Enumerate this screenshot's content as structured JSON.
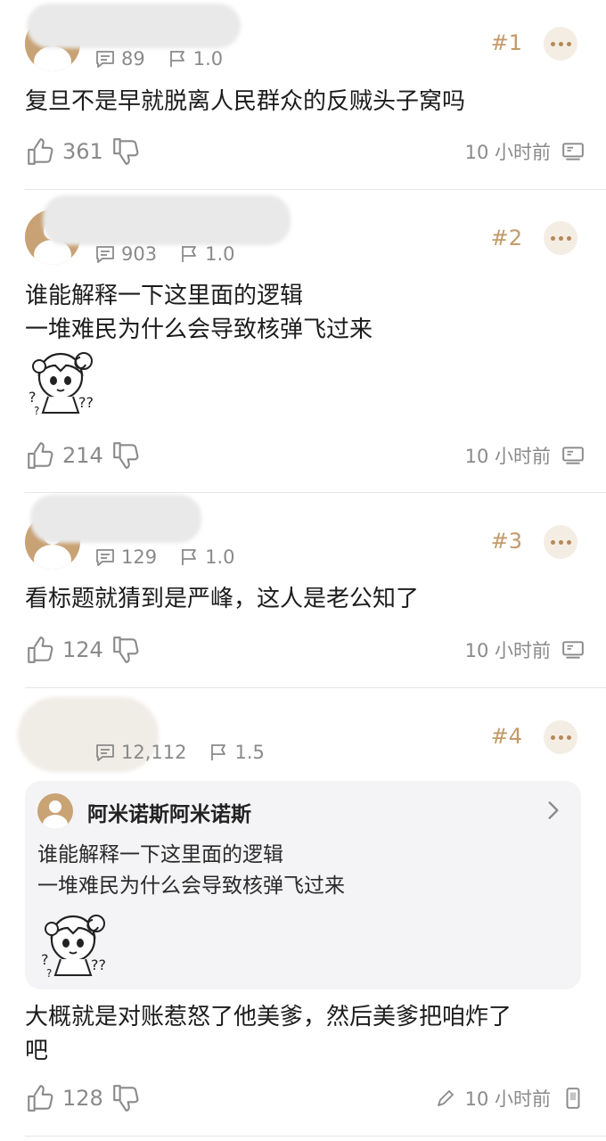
{
  "posts": [
    {
      "floor": "#1",
      "replies": "89",
      "ratio": "1.0",
      "text": "复旦不是早就脱离人民群众的反贼头子窝吗",
      "likes": "361",
      "time": "10 小时前",
      "device_icon": "desktop-icon"
    },
    {
      "floor": "#2",
      "replies": "903",
      "ratio": "1.0",
      "text": "谁能解释一下这里面的逻辑\n一堆难民为什么会导致核弹飞过来",
      "sticker": "confused-anime-girl-sticker",
      "likes": "214",
      "time": "10 小时前",
      "device_icon": "desktop-icon"
    },
    {
      "floor": "#3",
      "replies": "129",
      "ratio": "1.0",
      "text": "看标题就猜到是严峰，这人是老公知了",
      "likes": "124",
      "time": "10 小时前",
      "device_icon": "desktop-icon"
    },
    {
      "floor": "#4",
      "replies": "12,112",
      "ratio": "1.5",
      "quote": {
        "author": "阿米诺斯阿米诺斯",
        "text": "谁能解释一下这里面的逻辑\n一堆难民为什么会导致核弹飞过来",
        "sticker": "confused-anime-girl-sticker"
      },
      "text": "大概就是对账惹怒了他美爹，然后美爹把咱炸了\n吧",
      "likes": "128",
      "time": "10 小时前",
      "edit_icon": "pencil-icon",
      "device_icon": "phone-icon"
    }
  ],
  "colors": {
    "floor": "#c39a68",
    "meta_text": "#8a8a8a",
    "quote_bg": "#f4f4f6"
  }
}
